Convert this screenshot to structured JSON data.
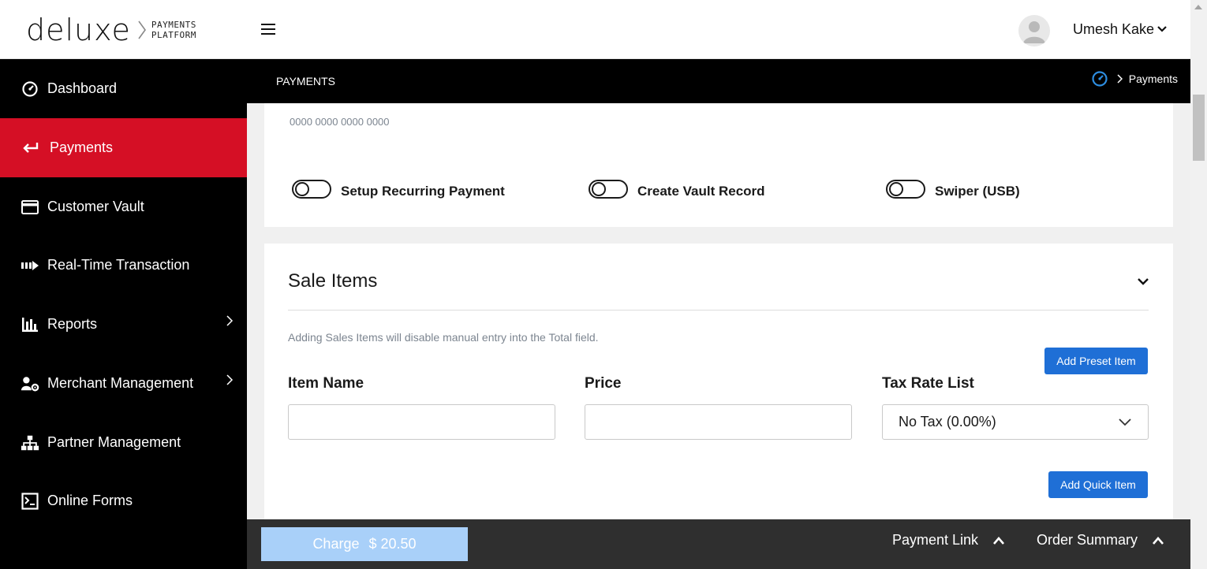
{
  "header": {
    "logo_word": "deluxe",
    "logo_sub_line1": "PAYMENTS",
    "logo_sub_line2": "PLATFORM",
    "user_name": "Umesh Kake"
  },
  "sidebar": {
    "items": [
      {
        "label": "Dashboard",
        "icon": "dashboard-icon"
      },
      {
        "label": "Payments",
        "icon": "return-arrow-icon",
        "active": true
      },
      {
        "label": "Customer Vault",
        "icon": "credit-card-icon"
      },
      {
        "label": "Real-Time Transaction",
        "icon": "fast-forward-icon"
      },
      {
        "label": "Reports",
        "icon": "bar-chart-icon",
        "has_submenu": true
      },
      {
        "label": "Merchant Management",
        "icon": "user-gear-icon",
        "has_submenu": true
      },
      {
        "label": "Partner Management",
        "icon": "org-chart-icon"
      },
      {
        "label": "Online Forms",
        "icon": "form-icon"
      }
    ]
  },
  "breadcrumb": {
    "page_title": "PAYMENTS",
    "current": "Payments"
  },
  "payment_card": {
    "card_number_placeholder": "0000 0000 0000 0000",
    "toggles": [
      {
        "label": "Setup Recurring Payment",
        "on": false
      },
      {
        "label": "Create Vault Record",
        "on": false
      },
      {
        "label": "Swiper (USB)",
        "on": false
      }
    ]
  },
  "sale_items": {
    "title": "Sale Items",
    "note": "Adding Sales Items will disable manual entry into the Total field.",
    "add_preset_label": "Add Preset Item",
    "add_quick_label": "Add Quick Item",
    "item_name_label": "Item Name",
    "item_name_value": "",
    "price_label": "Price",
    "price_value": "",
    "tax_label": "Tax Rate List",
    "tax_selected": "No Tax (0.00%)"
  },
  "bottom_bar": {
    "charge_label": "Charge",
    "charge_amount": "$ 20.50",
    "payment_link_label": "Payment Link",
    "order_summary_label": "Order Summary"
  },
  "colors": {
    "accent_red": "#d50f25",
    "button_blue": "#1f6fd6",
    "charge_disabled": "#a9d0f9",
    "sidebar_bg": "#000000"
  }
}
